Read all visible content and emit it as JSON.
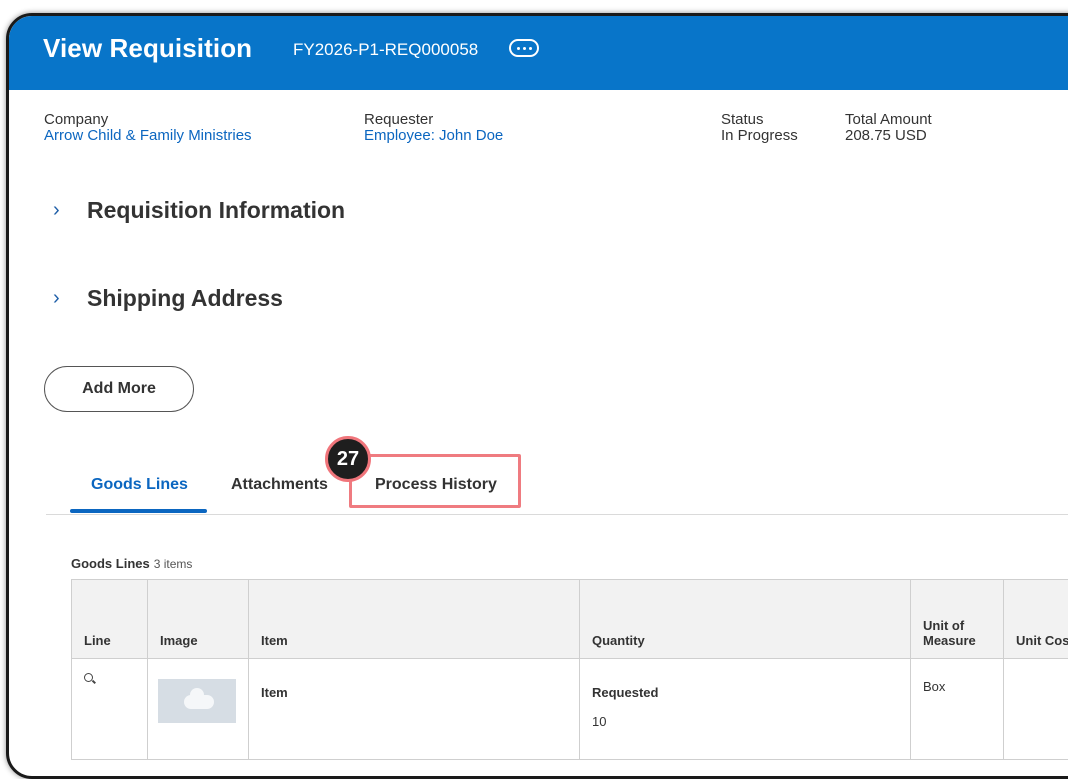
{
  "header": {
    "title": "View Requisition",
    "requisition_id": "FY2026-P1-REQ000058",
    "more_icon": "ellipsis-icon"
  },
  "summary": {
    "company_label": "Company",
    "company_value": "Arrow Child & Family Ministries",
    "requester_label": "Requester",
    "requester_value": "Employee: John Doe",
    "status_label": "Status",
    "status_value": "In Progress",
    "total_label": "Total Amount",
    "total_value": "208.75 USD"
  },
  "sections": [
    {
      "label": "Requisition Information",
      "icon": "chevron-right-icon"
    },
    {
      "label": "Shipping Address",
      "icon": "chevron-right-icon"
    }
  ],
  "add_more_label": "Add More",
  "tabs": [
    {
      "label": "Goods Lines",
      "active": true
    },
    {
      "label": "Attachments",
      "active": false
    },
    {
      "label": "Process History",
      "active": false
    }
  ],
  "callout": {
    "number": "27",
    "color": "#ef7b80"
  },
  "goods_lines": {
    "heading": "Goods Lines",
    "count": "3 items",
    "columns": [
      "Line",
      "Image",
      "Item",
      "Quantity",
      "Unit of Measure",
      "Unit Cos"
    ],
    "rows": [
      {
        "item": "Item",
        "quantity_label": "Requested",
        "quantity_value": "10",
        "unit": "Box"
      }
    ]
  },
  "colors": {
    "header": "#0875c9",
    "link": "#0b66c0"
  }
}
